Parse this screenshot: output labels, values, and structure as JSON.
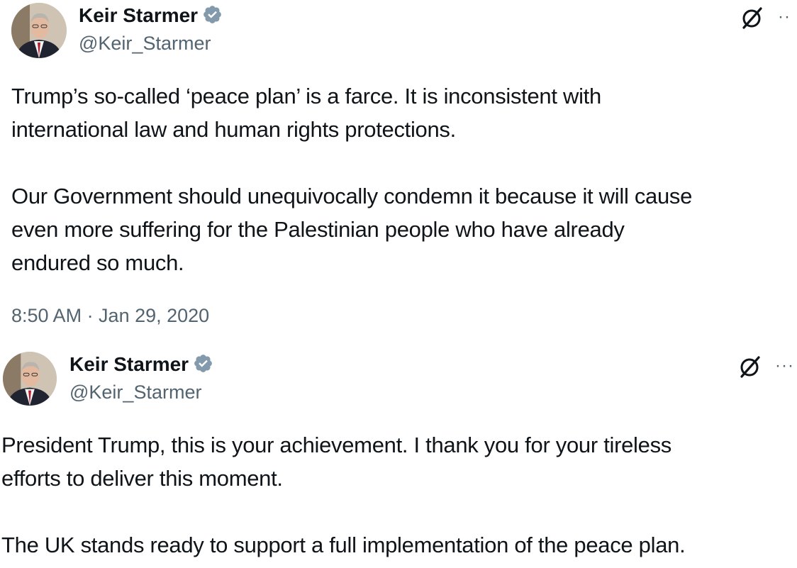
{
  "tweets": [
    {
      "display_name": "Keir Starmer",
      "handle": "@Keir_Starmer",
      "paragraphs": [
        [
          "Trump’s so-called ‘peace plan’ is a farce. It is inconsistent with",
          "international law and human rights protections."
        ],
        [
          "Our Government should unequivocally condemn it because it will cause",
          "even more suffering for the Palestinian people who have already",
          "endured so much."
        ]
      ],
      "timestamp": "8:50 AM · Jan 29, 2020",
      "more_label": "··"
    },
    {
      "display_name": "Keir Starmer",
      "handle": "@Keir_Starmer",
      "paragraphs": [
        [
          "President Trump, this is your achievement. I thank you for your tireless",
          "efforts to deliver this moment."
        ],
        [
          "The UK stands ready to support a full implementation of the peace plan."
        ]
      ],
      "more_label": "···"
    }
  ],
  "icons": {
    "verified": "verified-badge-icon",
    "grok": "grok-icon",
    "more": "more-options-icon"
  },
  "colors": {
    "verified_badge": "#829aab",
    "text_primary": "#0f1419",
    "text_secondary": "#536471"
  }
}
